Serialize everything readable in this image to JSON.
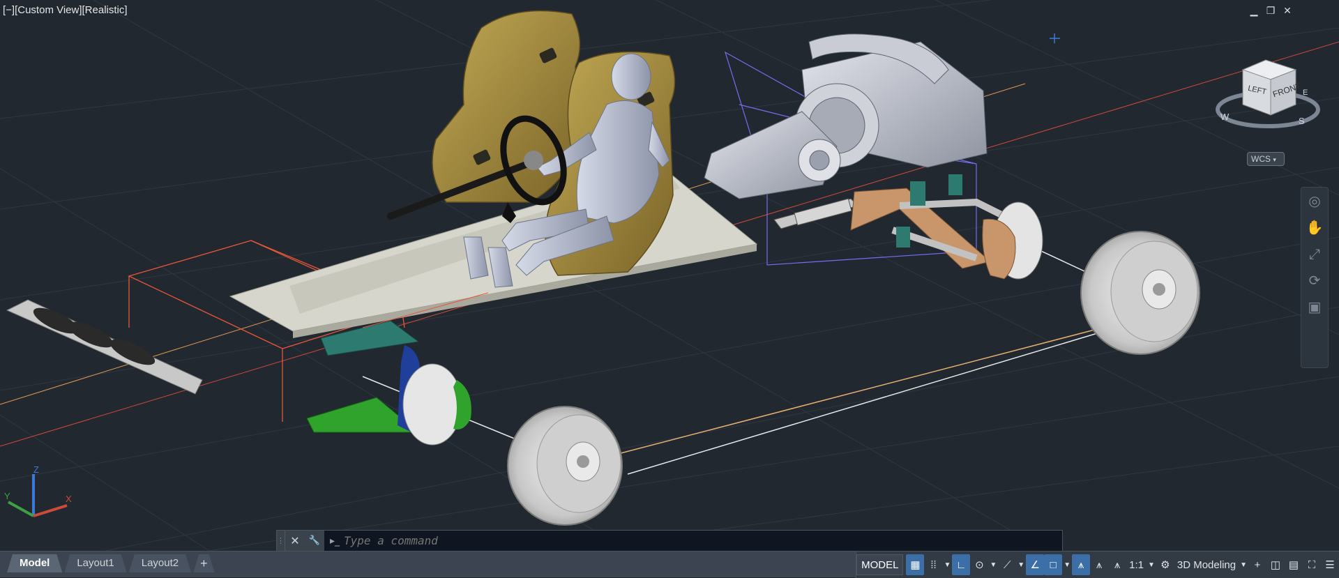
{
  "viewport": {
    "view_label": "[−][Custom View][Realistic]",
    "wcs_label": "WCS",
    "viewcube": {
      "face_left": "LEFT",
      "face_front": "FRONT",
      "compass": [
        "W",
        "S",
        "E"
      ]
    },
    "ucs": {
      "x": "X",
      "y": "Y",
      "z": "Z"
    },
    "window_controls": {
      "minimize": "▁",
      "restore": "❐",
      "close": "✕"
    }
  },
  "command_line": {
    "placeholder": "Type a command",
    "close_glyph": "✕",
    "settings_glyph": "🔧",
    "prompt_glyph": "▸_"
  },
  "layout_tabs": [
    {
      "label": "Model",
      "active": true
    },
    {
      "label": "Layout1",
      "active": false
    },
    {
      "label": "Layout2",
      "active": false
    }
  ],
  "add_tab_label": "+",
  "status": {
    "model_label": "MODEL",
    "scale_label": "1:1",
    "workspace_label": "3D Modeling"
  },
  "colors": {
    "background": "#212830",
    "grid": "#2e3742",
    "seat": "#a08a3e",
    "chassis": "#d6d6cc",
    "mannequin": "#a4abbe",
    "engine": "#b9bdc8",
    "rim": "#d9d9d9",
    "suspension_teal": "#2d7a70",
    "suspension_green": "#2fa32b",
    "copper": "#c9956a",
    "helper_orange": "#e8563a",
    "helper_purple": "#7a6cf0"
  }
}
